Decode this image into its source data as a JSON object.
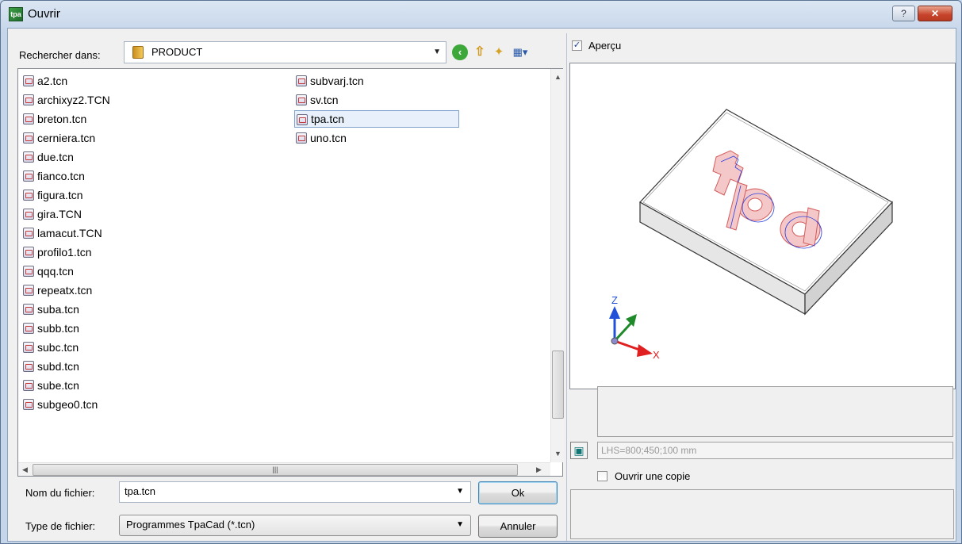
{
  "window": {
    "title": "Ouvrir",
    "app_icon_text": "tpa",
    "help_label": "?",
    "close_label": "✕"
  },
  "toolbar": {
    "lookin_label": "Rechercher dans:",
    "lookin_value": "PRODUCT",
    "icons": [
      "back-icon",
      "up-folder-icon",
      "new-folder-icon",
      "views-menu-icon"
    ]
  },
  "files": {
    "column1": [
      "a2.tcn",
      "archixyz2.TCN",
      "breton.tcn",
      "cerniera.tcn",
      "due.tcn",
      "fianco.tcn",
      "figura.tcn",
      "gira.TCN",
      "lamacut.TCN",
      "profilo1.tcn",
      "qqq.tcn",
      "repeatx.tcn",
      "suba.tcn",
      "subb.tcn",
      "subc.tcn",
      "subd.tcn",
      "sube.tcn",
      "subgeo0.tcn"
    ],
    "column2": [
      "subvarj.tcn",
      "sv.tcn",
      "tpa.tcn",
      "uno.tcn"
    ],
    "selected": "tpa.tcn"
  },
  "form": {
    "filename_label": "Nom du fichier:",
    "filename_value": "tpa.tcn",
    "filetype_label": "Type de fichier:",
    "filetype_value": "Programmes  TpaCad (*.tcn)",
    "ok_label": "Ok",
    "cancel_label": "Annuler"
  },
  "preview": {
    "checkbox_label": "Aperçu",
    "checked": true,
    "axis_z": "Z",
    "axis_x": "X",
    "dimensions": "LHS=800;450;100 mm",
    "open_copy_label": "Ouvrir une copie",
    "open_copy_checked": false
  },
  "colors": {
    "accent": "#3c7fb1",
    "selection": "#e8f1fb",
    "axis_red": "#e02020",
    "axis_green": "#1e8a2a",
    "axis_blue": "#2250d8"
  }
}
